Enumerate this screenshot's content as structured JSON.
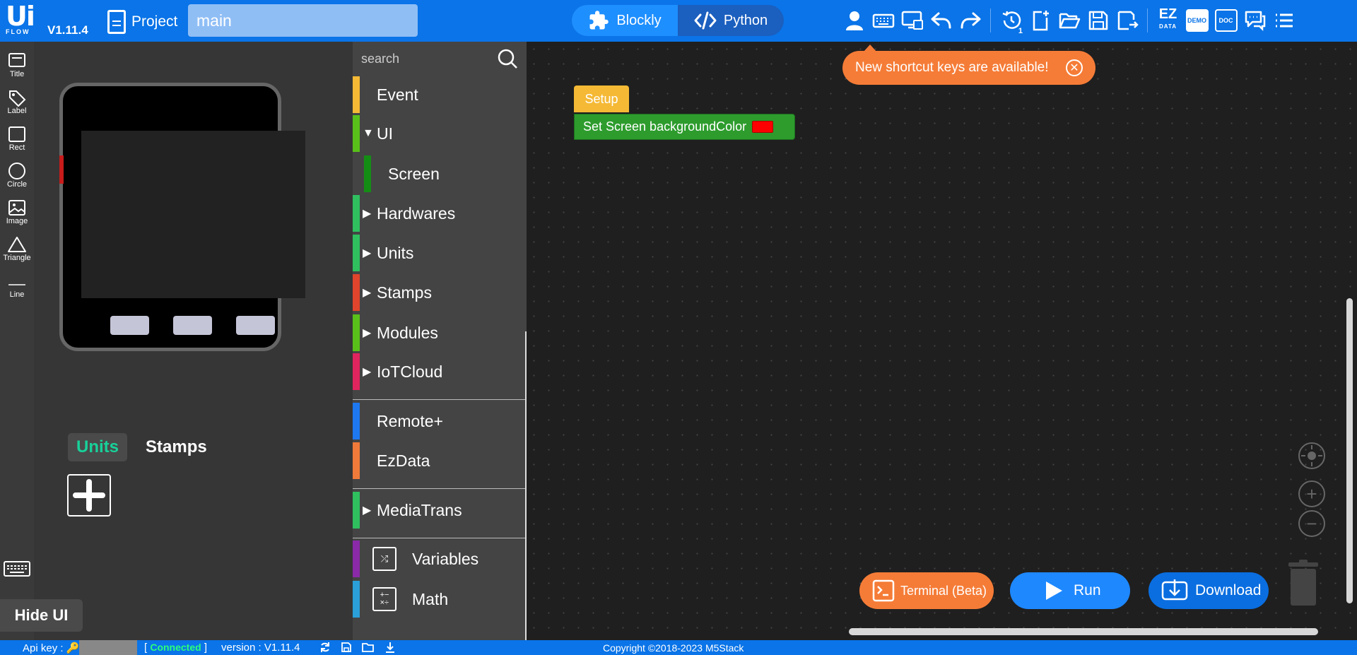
{
  "app": {
    "logo_text": "Ui",
    "logo_sub": "FLOW",
    "version": "V1.11.4",
    "project_label": "Project",
    "filename": "main",
    "modes": {
      "blockly": "Blockly",
      "python": "Python"
    },
    "toolbar": {
      "ez_data_main": "EZ",
      "ez_data_sub": "DATA",
      "demo": "DEMO",
      "doc": "DOC",
      "history_count": "1"
    }
  },
  "rail": {
    "items": [
      {
        "label": "Title",
        "icon": "title-icon"
      },
      {
        "label": "Label",
        "icon": "label-icon"
      },
      {
        "label": "Rect",
        "icon": "rect-icon"
      },
      {
        "label": "Circle",
        "icon": "circle-icon"
      },
      {
        "label": "Image",
        "icon": "image-icon"
      },
      {
        "label": "Triangle",
        "icon": "triangle-icon"
      },
      {
        "label": "Line",
        "icon": "line-icon"
      }
    ]
  },
  "device_panel": {
    "tabs": {
      "units": "Units",
      "stamps": "Stamps"
    },
    "hide_ui": "Hide UI"
  },
  "categories": {
    "search_placeholder": "search",
    "items": [
      {
        "label": "Event",
        "color": "#f5b935"
      },
      {
        "label": "UI",
        "color": "#59c01a",
        "expanded": true
      },
      {
        "label": "Screen",
        "color": "#148d14"
      },
      {
        "label": "Hardwares",
        "color": "#2fbf5f"
      },
      {
        "label": "Units",
        "color": "#2fbf5f"
      },
      {
        "label": "Stamps",
        "color": "#e0442c"
      },
      {
        "label": "Modules",
        "color": "#59c01a"
      },
      {
        "label": "IoTCloud",
        "color": "#e0245e"
      },
      {
        "label": "Remote+",
        "color": "#1e78f0"
      },
      {
        "label": "EzData",
        "color": "#f07a3a"
      },
      {
        "label": "MediaTrans",
        "color": "#2fbf5f"
      },
      {
        "label": "Variables",
        "color": "#8a2aa8"
      },
      {
        "label": "Math",
        "color": "#2a9fd8"
      }
    ]
  },
  "workspace": {
    "toast": "New shortcut keys are available!",
    "setup_block": "Setup",
    "set_block": "Set Screen backgroundColor",
    "set_block_color": "#ff0000",
    "buttons": {
      "terminal": "Terminal (Beta)",
      "run": "Run",
      "download": "Download"
    }
  },
  "status": {
    "api_key_label": "Api key :",
    "bracket_open": "[",
    "connected": "Connected",
    "bracket_close": "]",
    "version": "version : V1.11.4",
    "copyright": "Copyright ©2018-2023 M5Stack"
  }
}
